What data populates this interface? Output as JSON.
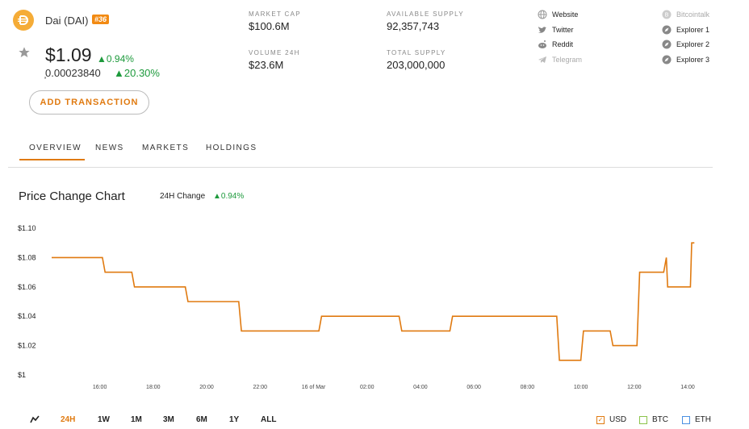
{
  "coin": {
    "name": "Dai (DAI)",
    "rank": "#36",
    "price": "$1.09",
    "price_change": "0.94%",
    "btc_price": "̦0.00023840",
    "btc_change": "20.30%"
  },
  "actions": {
    "add_transaction": "ADD TRANSACTION"
  },
  "stats": [
    {
      "label": "MARKET CAP",
      "value": "$100.6M"
    },
    {
      "label": "VOLUME 24H",
      "value": "$23.6M"
    },
    {
      "label": "AVAILABLE SUPPLY",
      "value": "92,357,743"
    },
    {
      "label": "TOTAL SUPPLY",
      "value": "203,000,000"
    }
  ],
  "links": {
    "left": [
      {
        "label": "Website",
        "icon": "globe-icon",
        "muted": false
      },
      {
        "label": "Twitter",
        "icon": "twitter-icon",
        "muted": false
      },
      {
        "label": "Reddit",
        "icon": "reddit-icon",
        "muted": false
      },
      {
        "label": "Telegram",
        "icon": "telegram-icon",
        "muted": true
      }
    ],
    "right": [
      {
        "label": "Bitcointalk",
        "icon": "bitcoin-icon",
        "muted": true
      },
      {
        "label": "Explorer 1",
        "icon": "compass-icon",
        "muted": false
      },
      {
        "label": "Explorer 2",
        "icon": "compass-icon",
        "muted": false
      },
      {
        "label": "Explorer 3",
        "icon": "compass-icon",
        "muted": false
      }
    ]
  },
  "tabs": [
    "OVERVIEW",
    "NEWS",
    "MARKETS",
    "HOLDINGS"
  ],
  "active_tab": "OVERVIEW",
  "chart_header": {
    "title": "Price Change Chart",
    "change_label": "24H Change",
    "change_value": "0.94%"
  },
  "ranges": [
    "24H",
    "1W",
    "1M",
    "3M",
    "6M",
    "1Y",
    "ALL"
  ],
  "active_range": "24H",
  "currencies": [
    {
      "label": "USD",
      "checked": true,
      "color": "#e07a10"
    },
    {
      "label": "BTC",
      "checked": false,
      "color": "#8bc34a"
    },
    {
      "label": "ETH",
      "checked": false,
      "color": "#4a90e2"
    }
  ],
  "colors": {
    "accent": "#e07a10",
    "up": "#1d9a3c",
    "line": "#e07a10"
  },
  "chart_data": {
    "type": "line",
    "title": "Price Change Chart",
    "xlabel": "",
    "ylabel": "",
    "ylim": [
      1.0,
      1.1
    ],
    "yticks": [
      "$1.10",
      "$1.08",
      "$1.06",
      "$1.04",
      "$1.02",
      "$1"
    ],
    "ytick_values": [
      1.1,
      1.08,
      1.06,
      1.04,
      1.02,
      1.0
    ],
    "xticks": [
      "16:00",
      "18:00",
      "20:00",
      "22:00",
      "16 of Mar",
      "02:00",
      "04:00",
      "06:00",
      "08:00",
      "10:00",
      "12:00",
      "14:00"
    ],
    "xtick_hours": [
      16,
      18,
      20,
      22,
      24,
      26,
      28,
      30,
      32,
      34,
      36,
      38
    ],
    "xrange_hours": [
      14.2,
      38.3
    ],
    "series": [
      {
        "values": [
          [
            14.2,
            1.08
          ],
          [
            16.1,
            1.08
          ],
          [
            16.2,
            1.07
          ],
          [
            17.2,
            1.07
          ],
          [
            17.3,
            1.06
          ],
          [
            19.2,
            1.06
          ],
          [
            19.3,
            1.05
          ],
          [
            21.2,
            1.05
          ],
          [
            21.3,
            1.03
          ],
          [
            24.2,
            1.03
          ],
          [
            24.3,
            1.04
          ],
          [
            27.2,
            1.04
          ],
          [
            27.3,
            1.03
          ],
          [
            29.1,
            1.03
          ],
          [
            29.2,
            1.04
          ],
          [
            33.1,
            1.04
          ],
          [
            33.2,
            1.01
          ],
          [
            34.0,
            1.01
          ],
          [
            34.1,
            1.03
          ],
          [
            35.1,
            1.03
          ],
          [
            35.2,
            1.02
          ],
          [
            36.1,
            1.02
          ],
          [
            36.2,
            1.07
          ],
          [
            37.1,
            1.07
          ],
          [
            37.2,
            1.08
          ],
          [
            37.25,
            1.06
          ],
          [
            38.1,
            1.06
          ],
          [
            38.15,
            1.09
          ],
          [
            38.25,
            1.09
          ]
        ]
      }
    ],
    "grid": false,
    "legend": "none"
  }
}
